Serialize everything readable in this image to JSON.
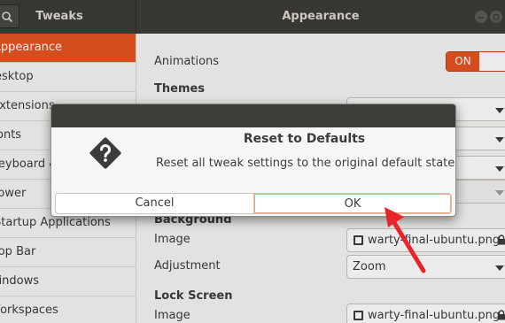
{
  "header": {
    "left_title": "Tweaks",
    "title": "Appearance"
  },
  "sidebar": {
    "items": [
      {
        "label": "Appearance",
        "active": true
      },
      {
        "label": "Desktop"
      },
      {
        "label": "Extensions"
      },
      {
        "label": "Fonts"
      },
      {
        "label": "Keyboard & Mouse"
      },
      {
        "label": "Power"
      },
      {
        "label": "Startup Applications"
      },
      {
        "label": "Top Bar"
      },
      {
        "label": "Windows"
      },
      {
        "label": "Workspaces"
      }
    ]
  },
  "content": {
    "animations_label": "Animations",
    "animations_switch": "ON",
    "themes_heading": "Themes",
    "background_heading": "Background",
    "bg_image_label": "Image",
    "bg_image_value": "warty-final-ubuntu.png",
    "bg_adjustment_label": "Adjustment",
    "bg_adjustment_value": "Zoom",
    "lock_heading": "Lock Screen",
    "lock_image_label": "Image",
    "lock_image_value": "warty-final-ubuntu.png"
  },
  "dialog": {
    "title": "Reset to Defaults",
    "message": "Reset all tweak settings to the original default state?",
    "cancel": "Cancel",
    "ok": "OK"
  },
  "colors": {
    "accent": "#e95420",
    "headerbar": "#3d3c38",
    "arrow": "#e8242b"
  },
  "icons": [
    "search-icon",
    "minimize-icon",
    "maximize-icon",
    "dropdown-arrow-icon",
    "file-icon",
    "lock-icon",
    "question-icon",
    "pointer-arrow"
  ]
}
